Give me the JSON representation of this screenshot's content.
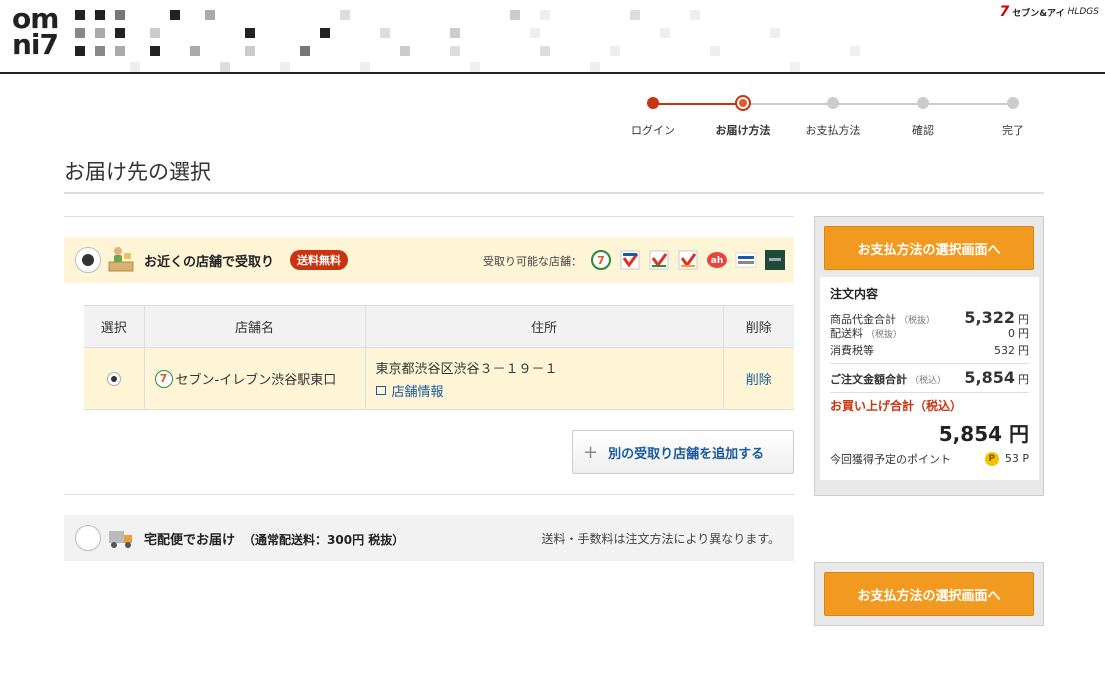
{
  "header": {
    "logo_line1": "om",
    "logo_line2": "ni7",
    "partner_mark": "7",
    "partner_name": "セブン&アイ",
    "partner_suffix": "HLDGS"
  },
  "progress": {
    "steps": [
      {
        "label": "ログイン"
      },
      {
        "label": "お届け方法"
      },
      {
        "label": "お支払方法"
      },
      {
        "label": "確認"
      },
      {
        "label": "完了"
      }
    ],
    "accent_color": "#c8340f"
  },
  "page_title": "お届け先の選択",
  "pickup": {
    "label": "お近くの店舗で受取り",
    "badge": "送料無料",
    "available_label": "受取り可能な店舗：",
    "store_logos": [
      "seven-eleven",
      "ito-yokado",
      "ito-yokado-2",
      "ito-yokado-3",
      "akachan-honpo",
      "sogo-seibu",
      "loft"
    ],
    "table": {
      "headers": [
        "選択",
        "店舗名",
        "住所",
        "削除"
      ],
      "rows": [
        {
          "store": "セブン-イレブン渋谷駅東口",
          "address": "東京都渋谷区渋谷３－１９－１",
          "info_link": "店舗情報",
          "delete": "削除"
        }
      ]
    },
    "add_store_button": "別の受取り店舗を追加する"
  },
  "delivery": {
    "label": "宅配便でお届け",
    "sub": "（通常配送料：300円 税抜）",
    "note": "送料・手数料は注文方法により異なります。"
  },
  "summary": {
    "cta": "お支払方法の選択画面へ",
    "heading": "注文内容",
    "subtotal_label": "商品代金合計",
    "subtotal_note": "（税抜）",
    "subtotal_value": "5,322",
    "shipping_label": "配送料",
    "shipping_note": "（税抜）",
    "shipping_value": "0",
    "tax_label": "消費税等",
    "tax_value": "532",
    "order_total_label": "ご注文金額合計",
    "order_total_note": "（税込）",
    "order_total_value": "5,854",
    "purchase_total_label": "お買い上げ合計（税込）",
    "purchase_total_value": "5,854 円",
    "points_label": "今回獲得予定のポイント",
    "points_icon": "P",
    "points_value": "53 P",
    "yen": "円"
  }
}
